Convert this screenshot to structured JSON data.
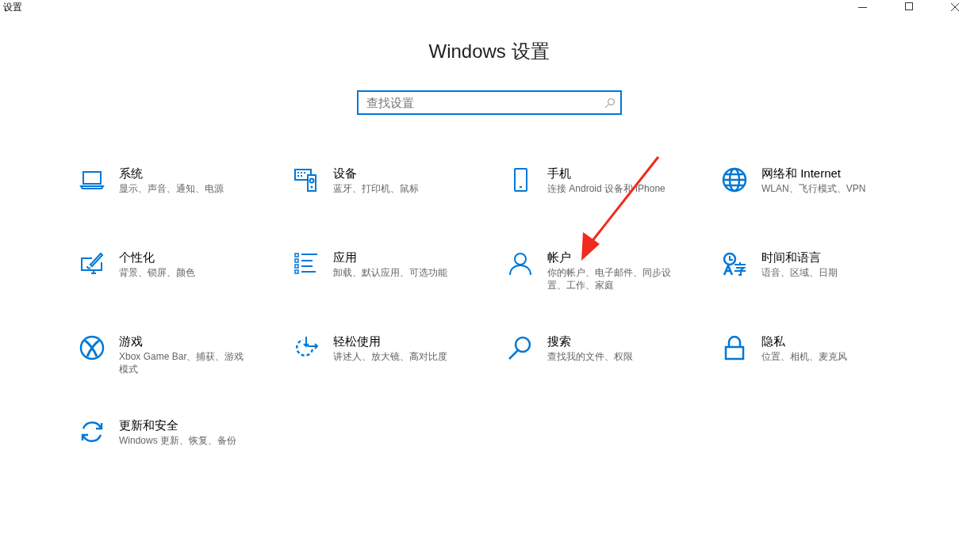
{
  "window": {
    "title": "设置"
  },
  "heading": "Windows 设置",
  "search": {
    "placeholder": "查找设置"
  },
  "settings": [
    {
      "title": "系统",
      "description": "显示、声音、通知、电源"
    },
    {
      "title": "设备",
      "description": "蓝牙、打印机、鼠标"
    },
    {
      "title": "手机",
      "description": "连接 Android 设备和 iPhone"
    },
    {
      "title": "网络和 Internet",
      "description": "WLAN、飞行模式、VPN"
    },
    {
      "title": "个性化",
      "description": "背景、锁屏、颜色"
    },
    {
      "title": "应用",
      "description": "卸载、默认应用、可选功能"
    },
    {
      "title": "帐户",
      "description": "你的帐户、电子邮件、同步设置、工作、家庭"
    },
    {
      "title": "时间和语言",
      "description": "语音、区域、日期"
    },
    {
      "title": "游戏",
      "description": "Xbox Game Bar、捕获、游戏模式"
    },
    {
      "title": "轻松使用",
      "description": "讲述人、放大镜、高对比度"
    },
    {
      "title": "搜索",
      "description": "查找我的文件、权限"
    },
    {
      "title": "隐私",
      "description": "位置、相机、麦克风"
    },
    {
      "title": "更新和安全",
      "description": "Windows 更新、恢复、备份"
    }
  ]
}
